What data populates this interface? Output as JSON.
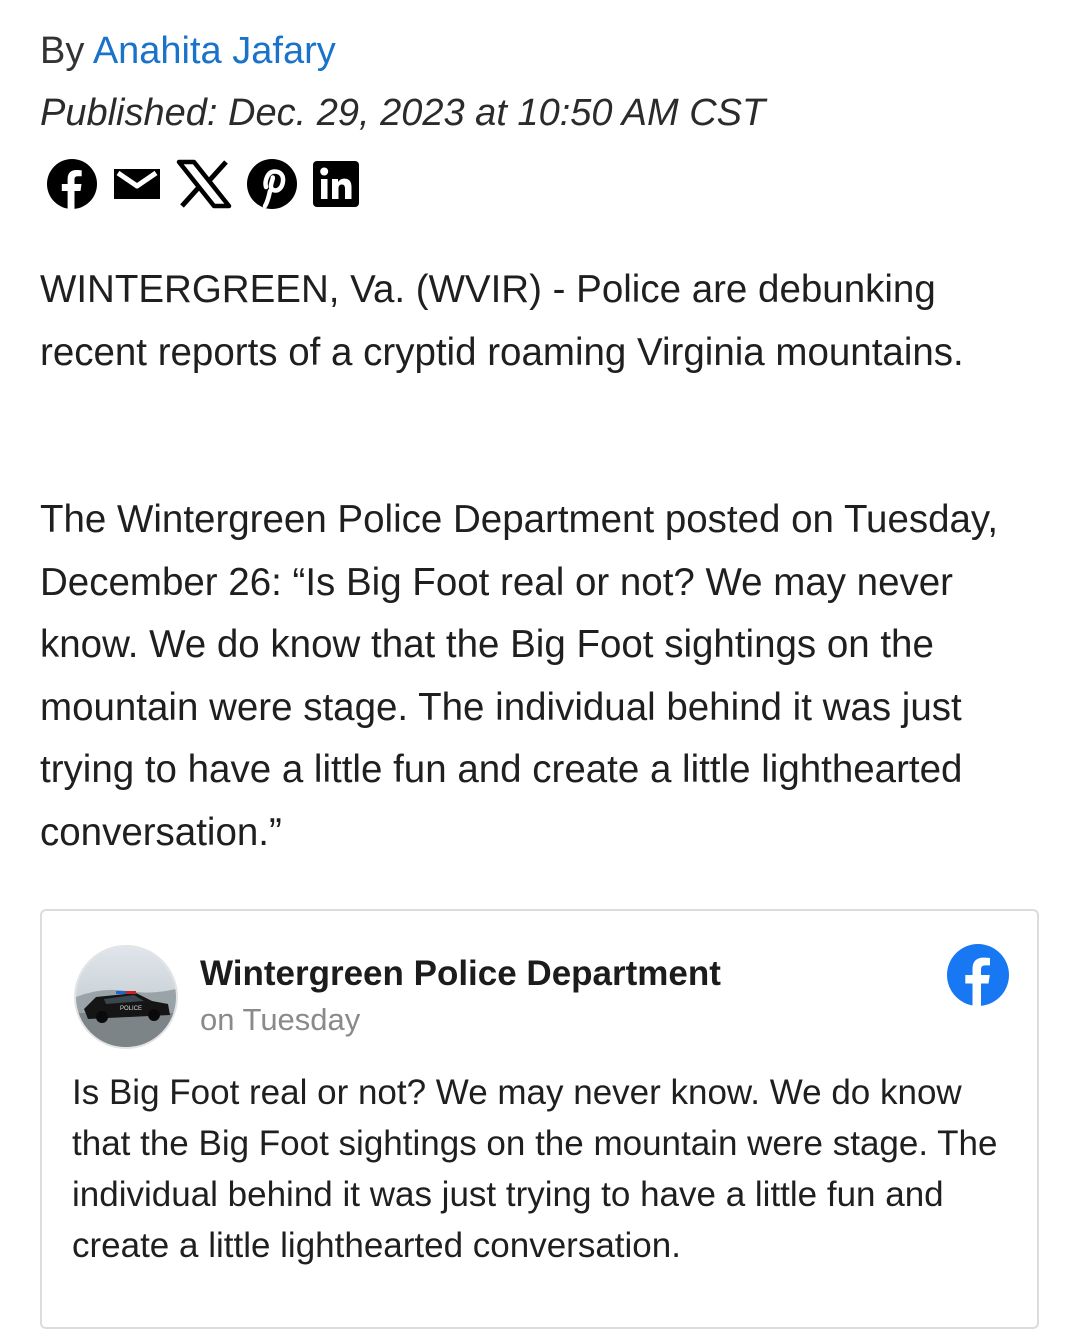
{
  "article": {
    "by_prefix": "By ",
    "author": "Anahita Jafary",
    "published": "Published: Dec. 29, 2023 at 10:50 AM CST",
    "share_icons": [
      "facebook-icon",
      "email-icon",
      "x-icon",
      "pinterest-icon",
      "linkedin-icon"
    ],
    "paragraphs": [
      "WINTERGREEN, Va. (WVIR) - Police are debunking recent reports of a cryptid roaming Virginia mountains.",
      "The Wintergreen Police Department posted on Tuesday, December 26: “Is Big Foot real or not? We may never know. We do know that the Big Foot sightings on the mountain were stage. The individual behind it was just trying to have a little fun and create a little lighthearted conversation.”"
    ]
  },
  "embed": {
    "page_name": "Wintergreen Police Department",
    "post_time": "on Tuesday",
    "post_text": "Is Big Foot real or not? We may never know. We do know that the Big Foot sightings on the mountain were stage. The individual behind it was just trying to have a little fun and create a little lighthearted conversation.",
    "brand_icon": "facebook-icon"
  },
  "colors": {
    "link": "#1a73c8",
    "facebook_blue": "#1877f2",
    "text": "#1f1f1f",
    "muted": "#8a8a8a"
  }
}
